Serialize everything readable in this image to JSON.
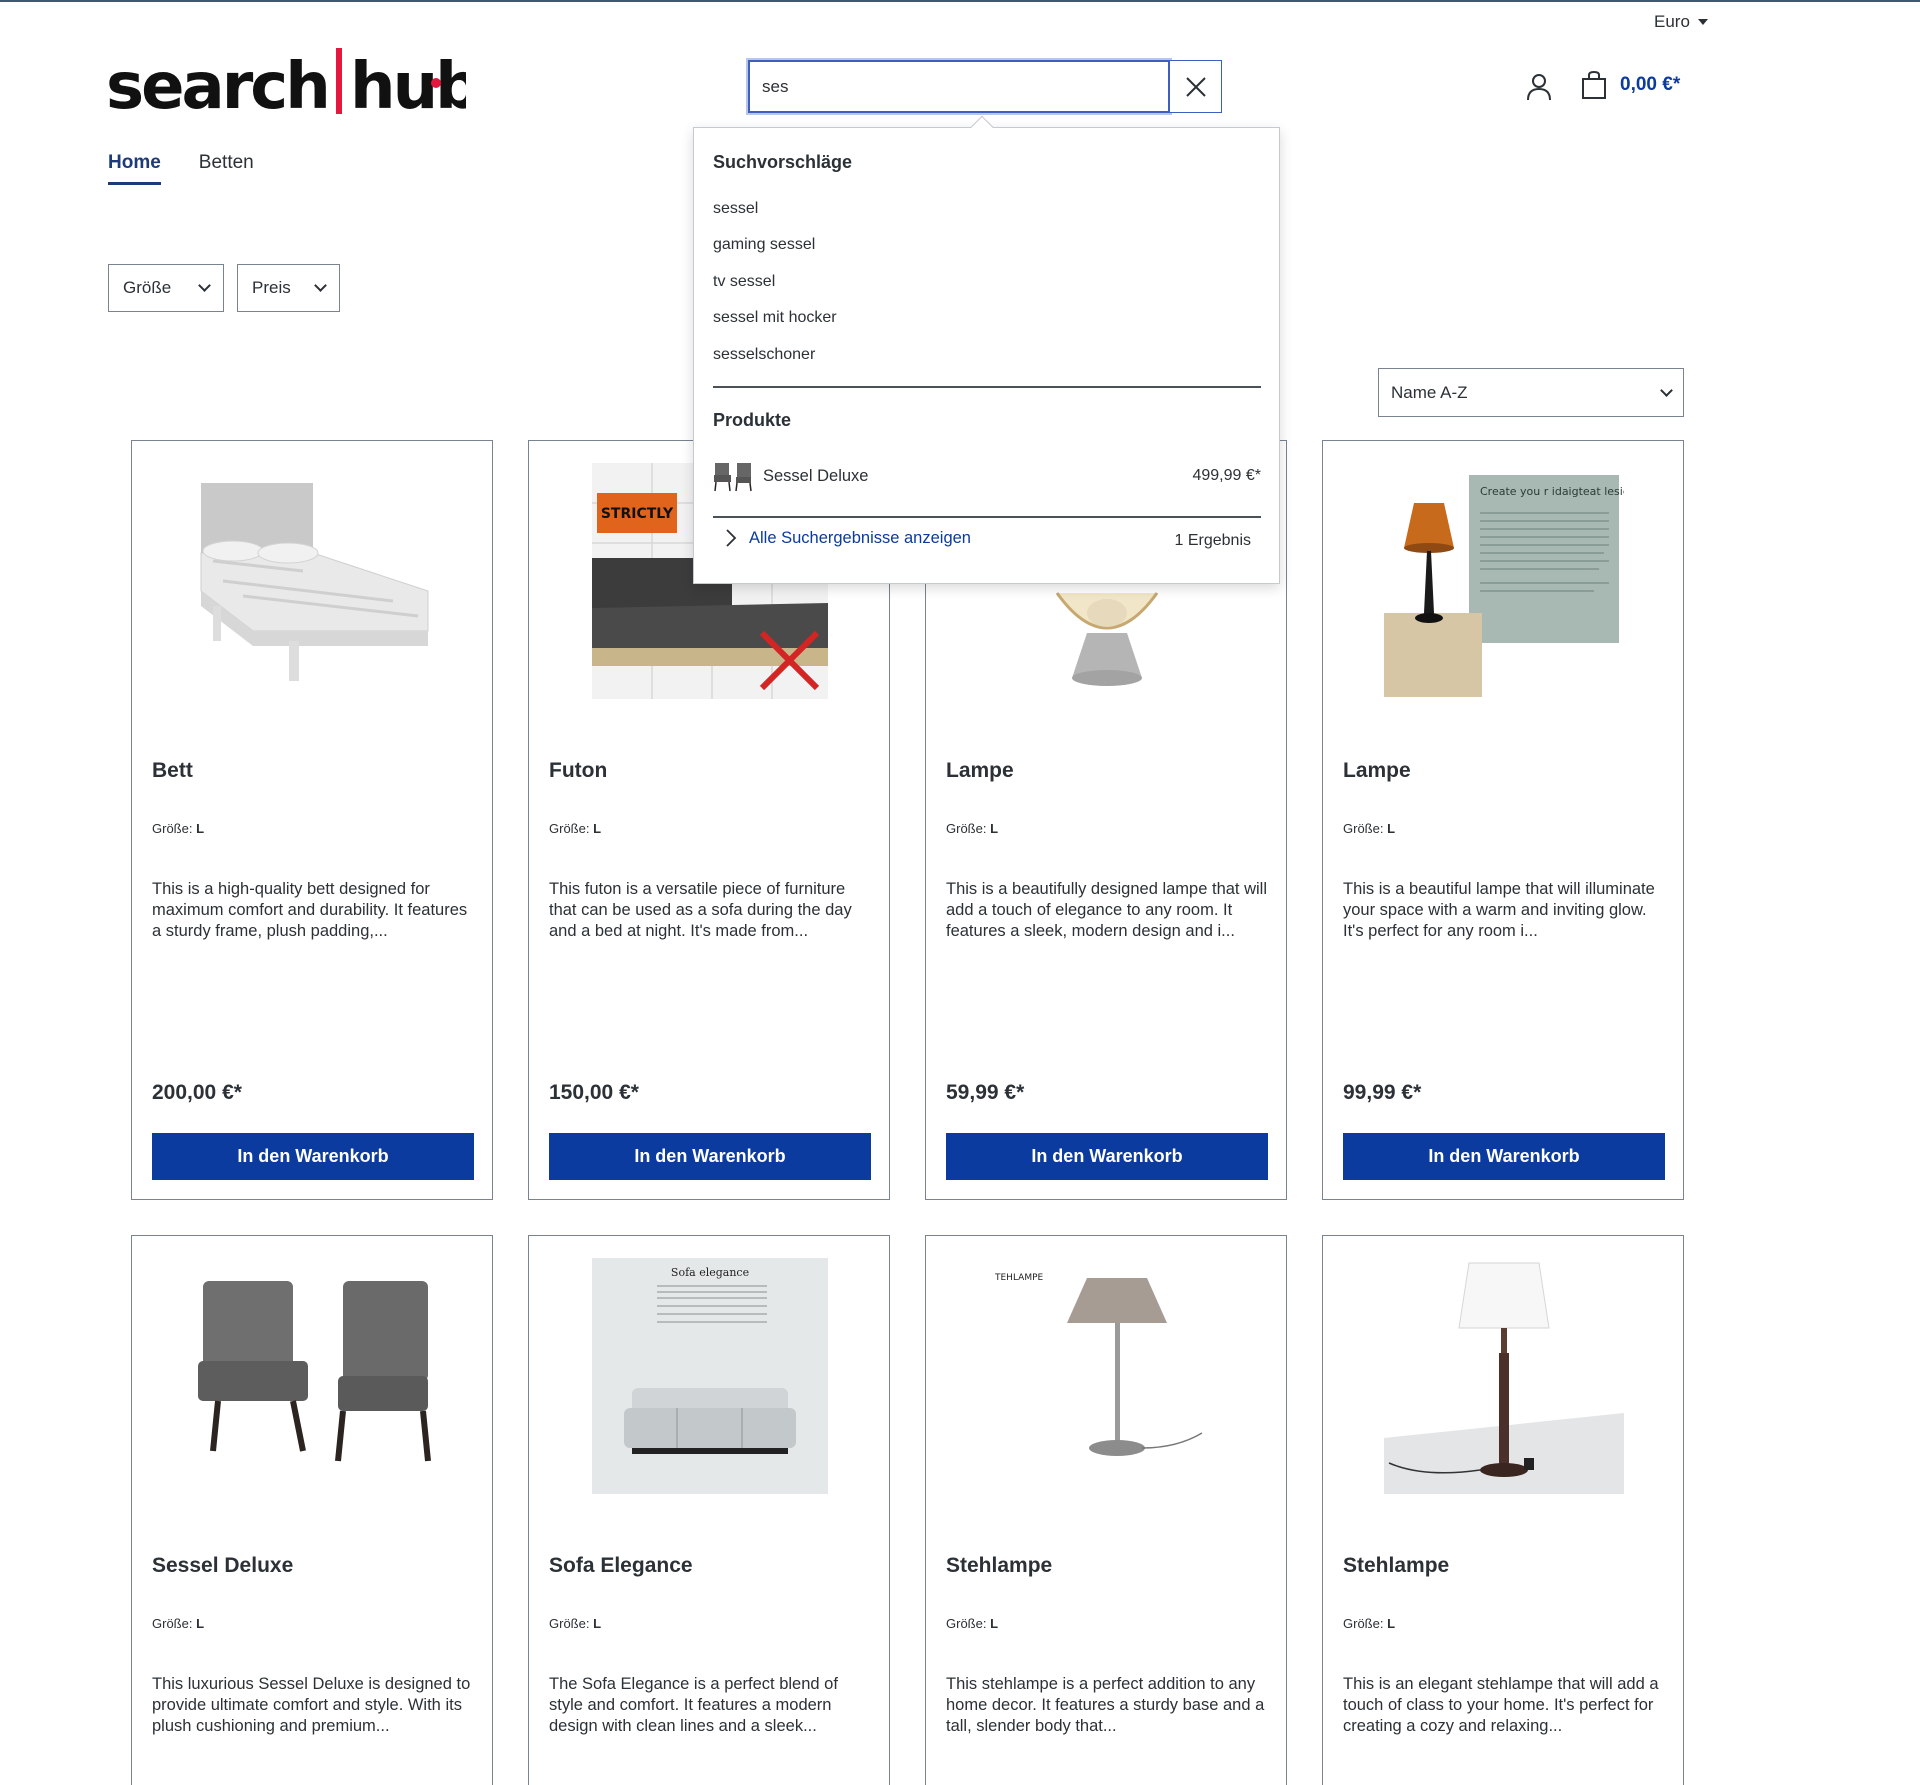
{
  "header": {
    "currency": "Euro",
    "search_value": "ses",
    "cart_total": "0,00 €*"
  },
  "nav": [
    {
      "label": "Home",
      "active": true
    },
    {
      "label": "Betten",
      "active": false
    }
  ],
  "filters": {
    "size": "Größe",
    "price": "Preis"
  },
  "sort": {
    "selected": "Name A-Z"
  },
  "suggest": {
    "suggestions_heading": "Suchvorschläge",
    "suggestions": [
      "sessel",
      "gaming sessel",
      "tv sessel",
      "sessel mit hocker",
      "sesselschoner"
    ],
    "products_heading": "Produkte",
    "product": {
      "name": "Sessel Deluxe",
      "price": "499,99 €*"
    },
    "all_results": "Alle Suchergebnisse anzeigen",
    "result_count": "1 Ergebnis"
  },
  "product_card": {
    "size_label": "Größe:",
    "buy_label": "In den Warenkorb"
  },
  "products": [
    {
      "title": "Bett",
      "size": "L",
      "desc": "This is a high-quality bett designed for maximum comfort and durability. It features a sturdy frame, plush padding,...",
      "price": "200,00 €*",
      "image_text": ""
    },
    {
      "title": "Futon",
      "size": "L",
      "desc": "This futon is a versatile piece of furniture that can be used as a sofa during the day and a bed at night. It's made from...",
      "price": "150,00 €*",
      "image_text": "STRICTLY"
    },
    {
      "title": "Lampe",
      "size": "L",
      "desc": "This is a beautifully designed lampe that will add a touch of elegance to any room. It features a sleek, modern design and i...",
      "price": "59,99 €*",
      "image_text": ""
    },
    {
      "title": "Lampe",
      "size": "L",
      "desc": "This is a beautiful lampe that will illuminate your space with a warm and inviting glow. It's perfect for any room i...",
      "price": "99,99 €*",
      "image_text": "Create you r idaigteat lesiged aeisgntd"
    },
    {
      "title": "Sessel Deluxe",
      "size": "L",
      "desc": "This luxurious Sessel Deluxe is designed to provide ultimate comfort and style. With its plush cushioning and premium...",
      "price": "",
      "image_text": ""
    },
    {
      "title": "Sofa Elegance",
      "size": "L",
      "desc": "The Sofa Elegance is a perfect blend of style and comfort. It features a modern design with clean lines and a sleek...",
      "price": "",
      "image_text": "Sofa elegance"
    },
    {
      "title": "Stehlampe",
      "size": "L",
      "desc": "This stehlampe is a perfect addition to any home decor. It features a sturdy base and a tall, slender body that...",
      "price": "",
      "image_text": "TEHLAMPE"
    },
    {
      "title": "Stehlampe",
      "size": "L",
      "desc": "This is an elegant stehlampe that will add a touch of class to your home. It's perfect for creating a cozy and relaxing...",
      "price": "",
      "image_text": ""
    }
  ],
  "colors": {
    "primary": "#0b3b9e",
    "text": "#2b3136",
    "accent_logo": "#e5173f"
  }
}
